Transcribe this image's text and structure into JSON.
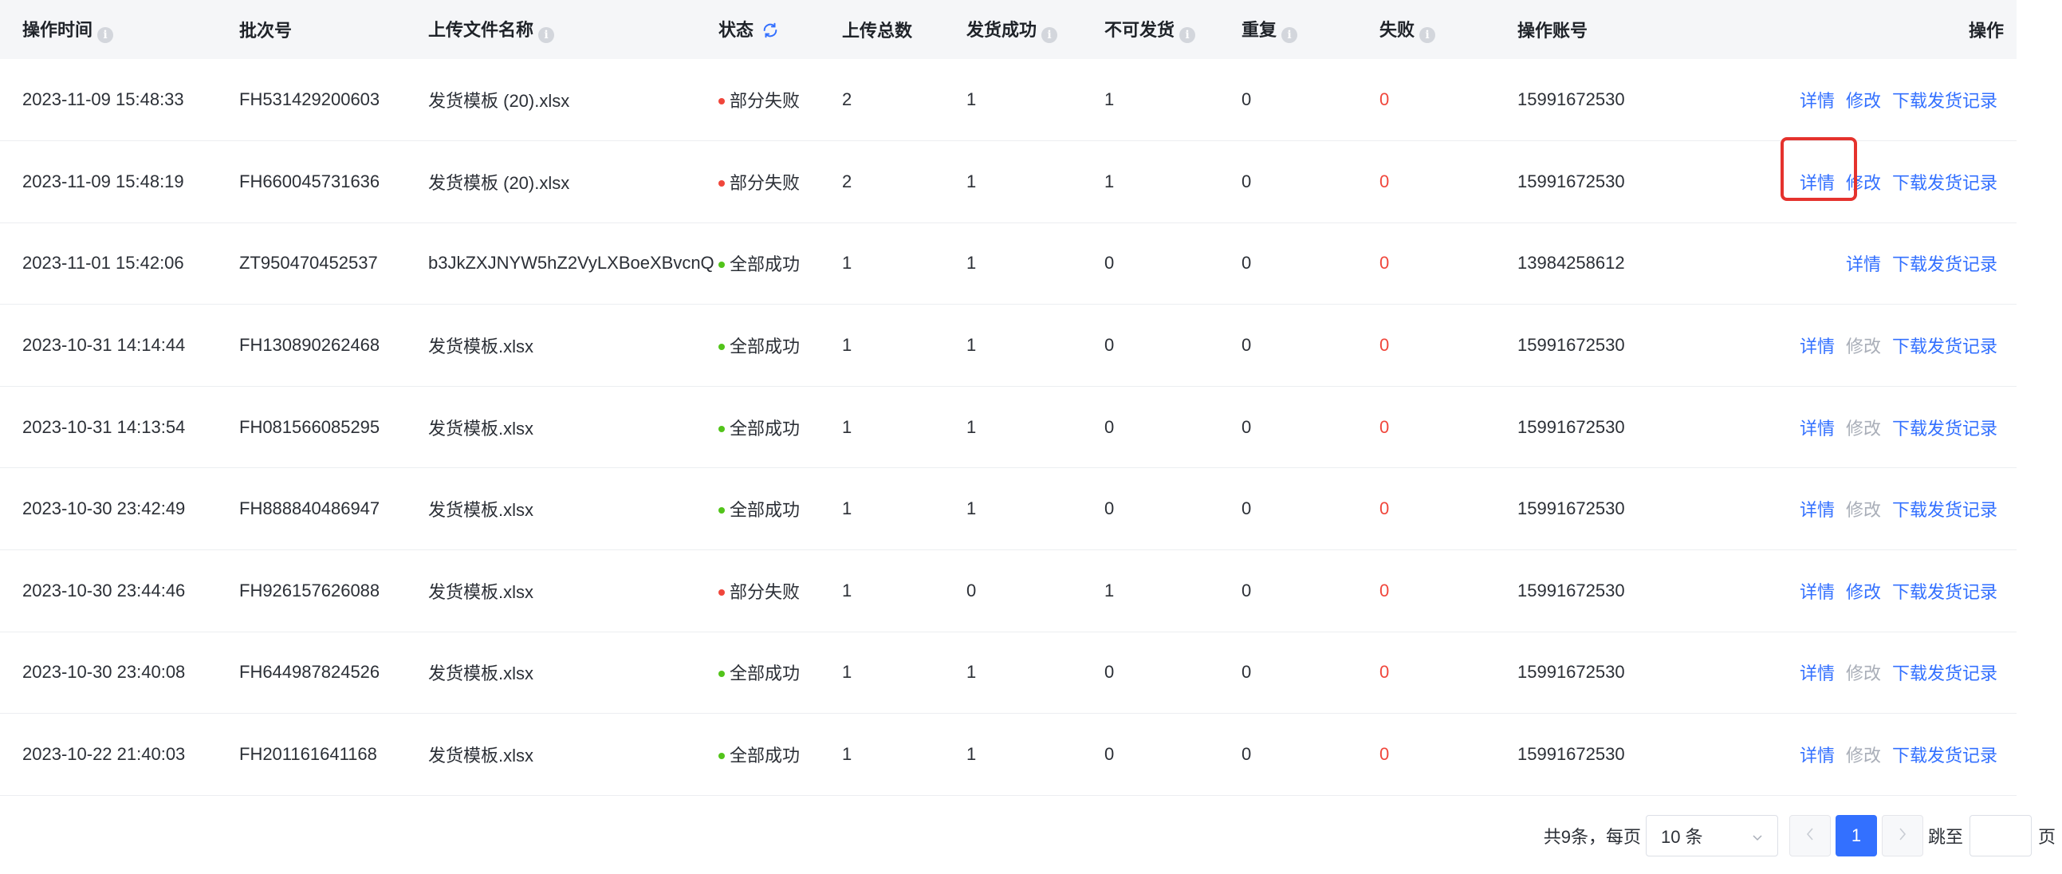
{
  "columns": {
    "time": "操作时间",
    "batch": "批次号",
    "file": "上传文件名称",
    "status": "状态",
    "total": "上传总数",
    "success": "发货成功",
    "unshippable": "不可发货",
    "duplicate": "重复",
    "failed": "失败",
    "account": "操作账号",
    "ops": "操作"
  },
  "icons": {
    "info": "info-circle-icon",
    "refresh": "refresh-icon",
    "prev": "chevron-left-icon",
    "next": "chevron-right-icon",
    "dropdown": "chevron-down-icon"
  },
  "colors": {
    "link": "#3370ff",
    "disabled": "#a9aeb8",
    "status_fail": "#f0463b",
    "status_success": "#52c41a",
    "fail_value": "#f0463b",
    "highlight": "#e5322d"
  },
  "rows": [
    {
      "time": "2023-11-09 15:48:33",
      "batch": "FH531429200603",
      "file": "发货模板 (20).xlsx",
      "status": "部分失败",
      "status_type": "fail",
      "total": "2",
      "success": "1",
      "unshippable": "1",
      "duplicate": "0",
      "failed": "0",
      "account": "15991672530",
      "ops": [
        {
          "label": "详情",
          "enabled": true
        },
        {
          "label": "修改",
          "enabled": true
        },
        {
          "label": "下载发货记录",
          "enabled": true
        }
      ]
    },
    {
      "time": "2023-11-09 15:48:19",
      "batch": "FH660045731636",
      "file": "发货模板 (20).xlsx",
      "status": "部分失败",
      "status_type": "fail",
      "total": "2",
      "success": "1",
      "unshippable": "1",
      "duplicate": "0",
      "failed": "0",
      "account": "15991672530",
      "ops": [
        {
          "label": "详情",
          "enabled": true,
          "highlight": true
        },
        {
          "label": "修改",
          "enabled": true
        },
        {
          "label": "下载发货记录",
          "enabled": true
        }
      ]
    },
    {
      "time": "2023-11-01 15:42:06",
      "batch": "ZT950470452537",
      "file": "b3JkZXJNYW5hZ2VyLXBoeXBvcnQ",
      "status": "全部成功",
      "status_type": "success",
      "total": "1",
      "success": "1",
      "unshippable": "0",
      "duplicate": "0",
      "failed": "0",
      "account": "13984258612",
      "ops": [
        {
          "label": "详情",
          "enabled": true
        },
        {
          "label": "下载发货记录",
          "enabled": true
        }
      ]
    },
    {
      "time": "2023-10-31 14:14:44",
      "batch": "FH130890262468",
      "file": "发货模板.xlsx",
      "status": "全部成功",
      "status_type": "success",
      "total": "1",
      "success": "1",
      "unshippable": "0",
      "duplicate": "0",
      "failed": "0",
      "account": "15991672530",
      "ops": [
        {
          "label": "详情",
          "enabled": true
        },
        {
          "label": "修改",
          "enabled": false
        },
        {
          "label": "下载发货记录",
          "enabled": true
        }
      ]
    },
    {
      "time": "2023-10-31 14:13:54",
      "batch": "FH081566085295",
      "file": "发货模板.xlsx",
      "status": "全部成功",
      "status_type": "success",
      "total": "1",
      "success": "1",
      "unshippable": "0",
      "duplicate": "0",
      "failed": "0",
      "account": "15991672530",
      "ops": [
        {
          "label": "详情",
          "enabled": true
        },
        {
          "label": "修改",
          "enabled": false
        },
        {
          "label": "下载发货记录",
          "enabled": true
        }
      ]
    },
    {
      "time": "2023-10-30 23:42:49",
      "batch": "FH888840486947",
      "file": "发货模板.xlsx",
      "status": "全部成功",
      "status_type": "success",
      "total": "1",
      "success": "1",
      "unshippable": "0",
      "duplicate": "0",
      "failed": "0",
      "account": "15991672530",
      "ops": [
        {
          "label": "详情",
          "enabled": true
        },
        {
          "label": "修改",
          "enabled": false
        },
        {
          "label": "下载发货记录",
          "enabled": true
        }
      ]
    },
    {
      "time": "2023-10-30 23:44:46",
      "batch": "FH926157626088",
      "file": "发货模板.xlsx",
      "status": "部分失败",
      "status_type": "fail",
      "total": "1",
      "success": "0",
      "unshippable": "1",
      "duplicate": "0",
      "failed": "0",
      "account": "15991672530",
      "ops": [
        {
          "label": "详情",
          "enabled": true
        },
        {
          "label": "修改",
          "enabled": true
        },
        {
          "label": "下载发货记录",
          "enabled": true
        }
      ]
    },
    {
      "time": "2023-10-30 23:40:08",
      "batch": "FH644987824526",
      "file": "发货模板.xlsx",
      "status": "全部成功",
      "status_type": "success",
      "total": "1",
      "success": "1",
      "unshippable": "0",
      "duplicate": "0",
      "failed": "0",
      "account": "15991672530",
      "ops": [
        {
          "label": "详情",
          "enabled": true
        },
        {
          "label": "修改",
          "enabled": false
        },
        {
          "label": "下载发货记录",
          "enabled": true
        }
      ]
    },
    {
      "time": "2023-10-22 21:40:03",
      "batch": "FH201161641168",
      "file": "发货模板.xlsx",
      "status": "全部成功",
      "status_type": "success",
      "total": "1",
      "success": "1",
      "unshippable": "0",
      "duplicate": "0",
      "failed": "0",
      "account": "15991672530",
      "ops": [
        {
          "label": "详情",
          "enabled": true
        },
        {
          "label": "修改",
          "enabled": false
        },
        {
          "label": "下载发货记录",
          "enabled": true
        }
      ]
    }
  ],
  "pagination": {
    "total_text": "共9条，每页",
    "page_size": "10 条",
    "current_page": "1",
    "jump_label": "跳至",
    "page_unit": "页",
    "jump_value": ""
  }
}
